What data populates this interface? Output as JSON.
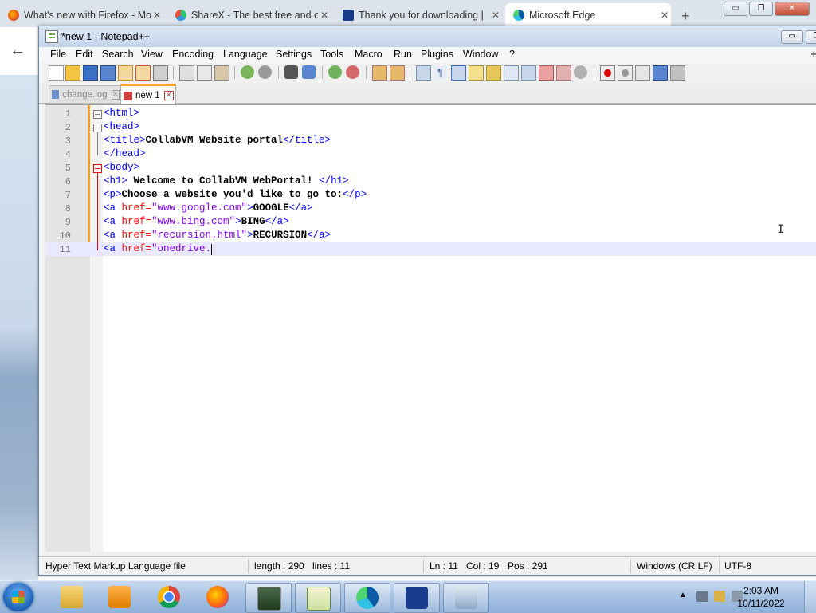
{
  "browser": {
    "tabs": [
      {
        "label": "What's new with Firefox - Mo",
        "icon": "firefox-icon"
      },
      {
        "label": "ShareX - The best free and op",
        "icon": "sharex-icon"
      },
      {
        "label": "Thank you for downloading |",
        "icon": "malwarebytes-icon"
      },
      {
        "label": "Microsoft Edge",
        "icon": "edge-icon"
      }
    ],
    "new_tab": "+",
    "back": "←"
  },
  "window": {
    "title": "*new 1 - Notepad++",
    "controls": {
      "minimize": "▭",
      "restore": "❐"
    }
  },
  "menu": [
    "File",
    "Edit",
    "Search",
    "View",
    "Encoding",
    "Language",
    "Settings",
    "Tools",
    "Macro",
    "Run",
    "Plugins",
    "Window",
    "?"
  ],
  "menu_plus": "+",
  "doc_tabs": [
    {
      "label": "change.log",
      "active": false
    },
    {
      "label": "new 1",
      "active": true
    }
  ],
  "editor": {
    "line_numbers": [
      "1",
      "2",
      "3",
      "4",
      "5",
      "6",
      "7",
      "8",
      "9",
      "10",
      "11"
    ],
    "current_line": 11,
    "caret": {
      "line": 11,
      "col": 19
    },
    "lines": [
      [
        {
          "t": "tag",
          "v": "<html>"
        }
      ],
      [
        {
          "t": "tag",
          "v": "<head>"
        }
      ],
      [
        {
          "t": "tag",
          "v": "<title>"
        },
        {
          "t": "txt",
          "v": "CollabVM Website portal"
        },
        {
          "t": "tag",
          "v": "</title>"
        }
      ],
      [
        {
          "t": "tag",
          "v": "</head>"
        }
      ],
      [
        {
          "t": "tag",
          "v": "<body>"
        }
      ],
      [
        {
          "t": "tag",
          "v": "<h1>"
        },
        {
          "t": "txt",
          "v": " Welcome to CollabVM WebPortal! "
        },
        {
          "t": "tag",
          "v": "</h1>"
        }
      ],
      [
        {
          "t": "tag",
          "v": "<p>"
        },
        {
          "t": "txt",
          "v": "Choose a website you'd like to go to:"
        },
        {
          "t": "tag",
          "v": "</p>"
        }
      ],
      [
        {
          "t": "tag",
          "v": "<a "
        },
        {
          "t": "attr",
          "v": "href="
        },
        {
          "t": "val",
          "v": "\"www.google.com\""
        },
        {
          "t": "tag",
          "v": ">"
        },
        {
          "t": "txt",
          "v": "GOOGLE"
        },
        {
          "t": "tag",
          "v": "</a>"
        }
      ],
      [
        {
          "t": "tag",
          "v": "<a "
        },
        {
          "t": "attr",
          "v": "href="
        },
        {
          "t": "val",
          "v": "\"www.bing.com\""
        },
        {
          "t": "tag",
          "v": ">"
        },
        {
          "t": "txt",
          "v": "BING"
        },
        {
          "t": "tag",
          "v": "</a>"
        }
      ],
      [
        {
          "t": "tag",
          "v": "<a "
        },
        {
          "t": "attr",
          "v": "href="
        },
        {
          "t": "val",
          "v": "\"recursion.html\""
        },
        {
          "t": "tag",
          "v": ">"
        },
        {
          "t": "txt",
          "v": "RECURSION"
        },
        {
          "t": "tag",
          "v": "</a>"
        }
      ],
      [
        {
          "t": "tag",
          "v": "<a "
        },
        {
          "t": "attr",
          "v": "href="
        },
        {
          "t": "val",
          "v": "\"onedrive."
        }
      ]
    ]
  },
  "status": {
    "file_type": "Hyper Text Markup Language file",
    "length": "length : 290",
    "lines": "lines : 11",
    "ln": "Ln : 11",
    "col": "Col : 19",
    "pos": "Pos : 291",
    "eol": "Windows (CR LF)",
    "encoding": "UTF-8"
  },
  "taskbar": {
    "apps": [
      "file-explorer-icon",
      "media-player-icon",
      "chrome-icon",
      "firefox-icon",
      "task-manager-icon",
      "notepadpp-icon",
      "edge-icon",
      "malwarebytes-icon",
      "control-panel-icon"
    ],
    "clock_time": "2:03 AM",
    "clock_date": "10/11/2022"
  },
  "colors": {
    "tag": "#0000ff",
    "attribute": "#ff0000",
    "value": "#8000ff",
    "current_line": "#e8e8ff",
    "change_bar": "#f0a030"
  }
}
